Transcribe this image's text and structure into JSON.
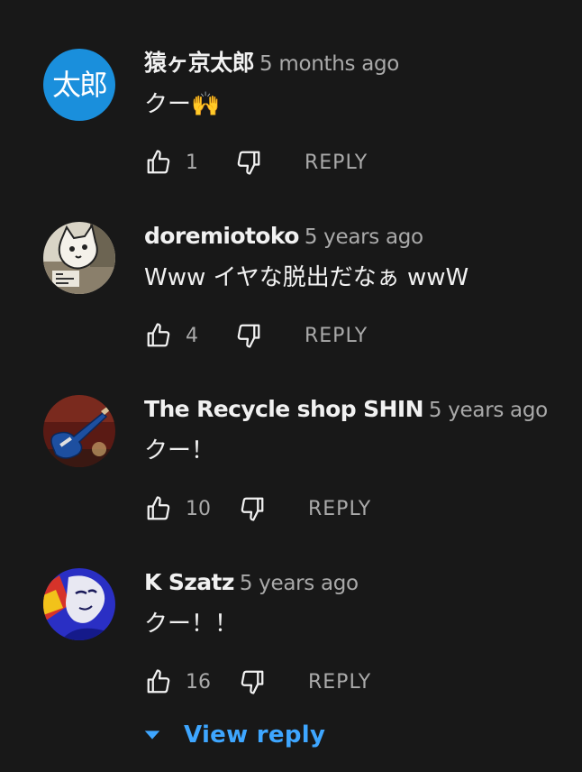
{
  "comments": [
    {
      "author": "猿ヶ京太郎",
      "time": "5 months ago",
      "text": "クー🙌",
      "likes": "1",
      "reply_label": "REPLY",
      "avatar_text": "太郎",
      "avatar_color": "#1a8fdc"
    },
    {
      "author": "doremiotoko",
      "time": "5 years ago",
      "text": "Www イヤな脱出だなぁ wwW",
      "likes": "4",
      "reply_label": "REPLY"
    },
    {
      "author": "The Recycle shop SHIN",
      "time": "5 years ago",
      "text": "クー！",
      "likes": "10",
      "reply_label": "REPLY"
    },
    {
      "author": "K Szatz",
      "time": "5 years ago",
      "text": "クー！！",
      "likes": "16",
      "reply_label": "REPLY"
    }
  ],
  "view_reply": {
    "label": "View reply",
    "icon": "caret-down-icon",
    "color": "#3ea6ff"
  },
  "colors": {
    "background": "#181818",
    "primary_text": "#f1f1f1",
    "secondary_text": "#aaaaaa"
  }
}
